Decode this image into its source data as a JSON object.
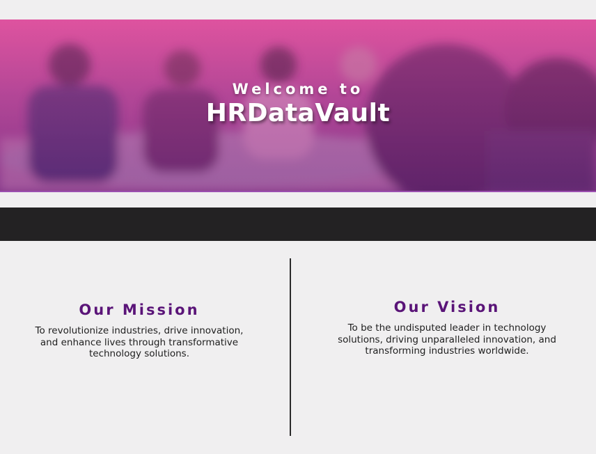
{
  "hero": {
    "welcome": "Welcome to",
    "brand": "HRDataVault",
    "gradient_top": "#e0569e",
    "gradient_bottom": "#8a3c8c"
  },
  "navbar": {
    "background": "#232223"
  },
  "mission": {
    "title": "Our Mission",
    "text": "To revolutionize industries, drive innovation, and enhance lives through transformative technology solutions."
  },
  "vision": {
    "title": "Our Vision",
    "text": "To be the undisputed leader in technology solutions, driving unparalleled innovation, and transforming industries worldwide."
  },
  "colors": {
    "accent": "#5a1478",
    "page_background": "#f0eff0"
  }
}
